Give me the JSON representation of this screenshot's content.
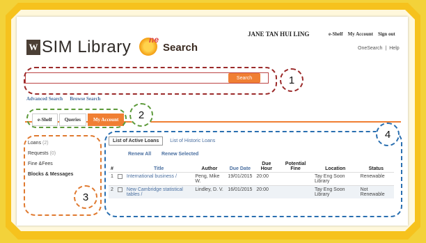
{
  "header": {
    "logo_mark": "W",
    "logo_text": "SIM Library",
    "onesearch_one": "ne",
    "onesearch_search": "Search",
    "user_name": "JANE TAN HUI LING",
    "top_links": [
      "e-Shelf",
      "My Account",
      "Sign out"
    ],
    "sub_links": [
      "OneSearch",
      "|",
      "Help"
    ]
  },
  "search": {
    "value": "",
    "button_label": "Search",
    "links": [
      "Advanced Search",
      "Browse Search"
    ]
  },
  "tabs": [
    {
      "label": "e-Shelf",
      "active": false
    },
    {
      "label": "Queries",
      "active": false
    },
    {
      "label": "My Account",
      "active": true
    }
  ],
  "sidenav": [
    {
      "label": "Loans",
      "count": "(2)"
    },
    {
      "label": "Requests",
      "count": "(0)"
    },
    {
      "label": "Fine &Fees",
      "count": ""
    },
    {
      "label": "Blocks & Messages",
      "count": ""
    }
  ],
  "content": {
    "tab_active": "List of Active Loans",
    "tab_other": "List of Historic Loans",
    "renew_all": "Renew All",
    "renew_selected": "Renew Selected",
    "columns": [
      "#",
      "",
      "Title",
      "Author",
      "Due Date",
      "Due Hour",
      "Potential Fine",
      "Location",
      "Status"
    ],
    "rows": [
      {
        "num": "1",
        "title": "International business /",
        "author": "Peng, Mike W.",
        "due_date": "19/01/2015",
        "due_hour": "20:00",
        "fine": "",
        "location": "Tay Eng Soon Library",
        "status": "Renewable"
      },
      {
        "num": "2",
        "title": "New Cambridge statistical tables /",
        "author": "Lindley, D. V.",
        "due_date": "16/01/2015",
        "due_hour": "20:00",
        "fine": "",
        "location": "Tay Eng Soon Library",
        "status": "Not Renewable"
      }
    ]
  },
  "annotations": [
    "1",
    "2",
    "3",
    "4"
  ],
  "colors": {
    "accent_orange": "#f07f33",
    "annotation_red": "#9b2a2a",
    "annotation_green": "#5c9a3a",
    "annotation_orange": "#e07a30",
    "annotation_blue": "#2a6fb0",
    "frame_yellow": "#f6c21d"
  }
}
